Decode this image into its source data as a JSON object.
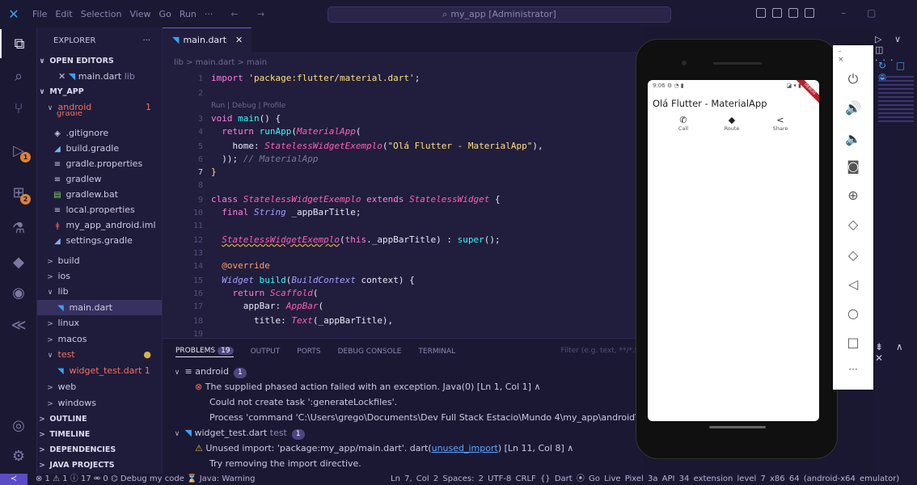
{
  "titlebar": {
    "menu": [
      "File",
      "Edit",
      "Selection",
      "View",
      "Go",
      "Run",
      "···"
    ],
    "nav": "← →",
    "search": "my_app [Administrator]"
  },
  "sidebar": {
    "title": "EXPLORER",
    "more": "···",
    "open_editors": "OPEN EDITORS",
    "open_file": "main.dart",
    "open_file_dir": "lib",
    "project": "MY_APP",
    "android_folder": "android",
    "android_count": "1",
    "gradle_partial": "gradle",
    "files": [
      ".gitignore",
      "build.gradle",
      "gradle.properties",
      "gradlew",
      "gradlew.bat",
      "local.properties",
      "my_app_android.iml",
      "settings.gradle"
    ],
    "folders_a": [
      "build",
      "ios",
      "lib"
    ],
    "lib_file": "main.dart",
    "folders_b": [
      "linux",
      "macos"
    ],
    "test_folder": "test",
    "test_file": "widget_test.dart",
    "test_file_count": "1",
    "folders_c": [
      "web",
      "windows"
    ],
    "sections": [
      "OUTLINE",
      "TIMELINE",
      "DEPENDENCIES",
      "JAVA PROJECTS"
    ]
  },
  "editor": {
    "tab": "main.dart",
    "tab_close": "✕",
    "breadcrumb": "lib > main.dart > main",
    "codelens": "Run | Debug | Profile",
    "line_numbers": [
      "1",
      "2",
      "3",
      "4",
      "5",
      "6",
      "7",
      "8",
      "9",
      "10",
      "11",
      "12",
      "13",
      "14",
      "15",
      "16",
      "17",
      "18",
      "19"
    ]
  },
  "panel": {
    "tabs": [
      "PROBLEMS",
      "OUTPUT",
      "PORTS",
      "DEBUG CONSOLE",
      "TERMINAL"
    ],
    "problem_count": "19",
    "filter_placeholder": "Filter (e.g. text, **/*.ts,",
    "group1": "android",
    "group1_count": "1",
    "error_msg": "The supplied phased action failed with an exception. Java(0) [Ln 1, Col 1]",
    "error_line2": "Could not create task ':generateLockfiles'.",
    "error_line3": "Process 'command 'C:\\Users\\grego\\Documents\\Dev Full Stack Estacio\\Mundo 4\\my_app\\android\\gradle",
    "group2": "widget_test.dart",
    "group2_dir": "test",
    "group2_count": "1",
    "warn_msg_a": "Unused import: 'package:my_app/main.dart'. dart(",
    "warn_link": "unused_import",
    "warn_msg_b": ") [Ln 11, Col 8]",
    "warn_line2": "Try removing the import directive."
  },
  "statusbar": {
    "remote": "≺",
    "left": "⊗ 1 ⚠ 1 ⓘ 17   ⚮ 0   ⌬ Debug my code   ⌛ Java: Warning",
    "right": "Ln 7, Col 2   Spaces: 2   UTF-8   CRLF   {} Dart   ⦿ Go Live   Pixel 3a API 34 extension level 7 x86 64 (android-x64 emulator)"
  },
  "emulator": {
    "status_time": "9:06",
    "status_icons": "⚙ ◔ ▮",
    "status_right": "◪ ▾ ▮",
    "debug_banner": "DEBUG",
    "app_title": "Olá Flutter - MaterialApp",
    "actions": [
      {
        "icon": "✆",
        "label": "Call"
      },
      {
        "icon": "◆",
        "label": "Route"
      },
      {
        "icon": "<",
        "label": "Share"
      }
    ]
  },
  "emu_controls": {
    "window": "– ×",
    "buttons": [
      "⏻",
      "🔊",
      "🔈",
      "◙",
      "⊕",
      "◇",
      "◇",
      "◁",
      "○",
      "□",
      "···"
    ]
  },
  "right_panel": {
    "top": "▷ ∨ ◫ ···",
    "minimap": "↻ □ ◉",
    "panel_ctrl": "⇟ ∧ ✕"
  }
}
